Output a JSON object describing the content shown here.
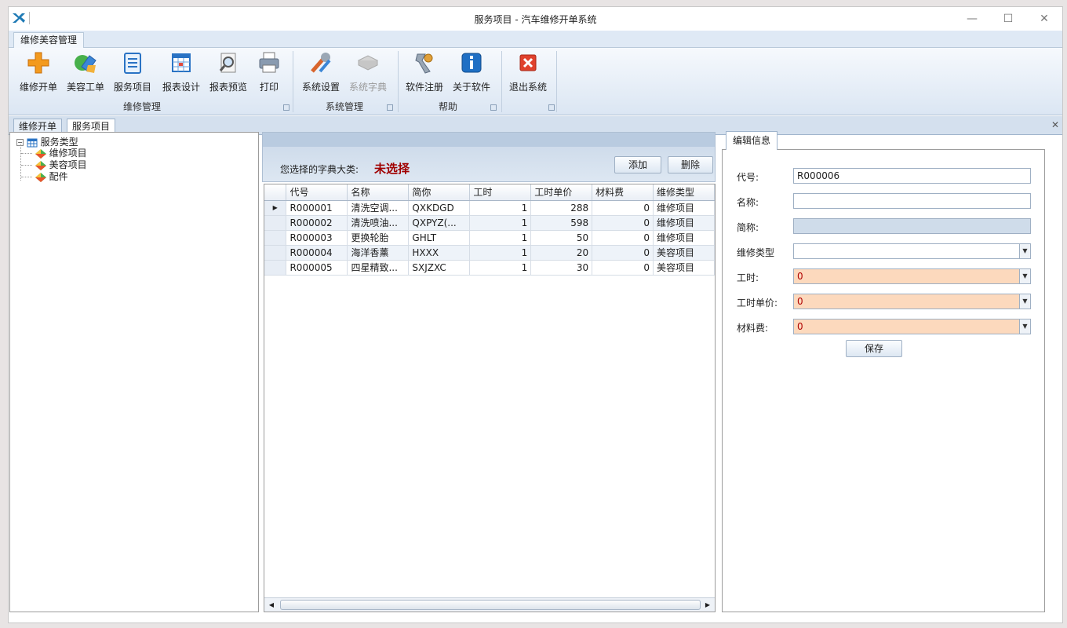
{
  "window": {
    "title": "服务项目 -      汽车维修开单系统",
    "minimize": "—",
    "maximize": "☐",
    "close": "✕"
  },
  "ribbon": {
    "tab": "维修美容管理",
    "buttons": [
      {
        "label": "维修开单",
        "icon": "plus-icon"
      },
      {
        "label": "美容工单",
        "icon": "car-wash-icon"
      },
      {
        "label": "服务项目",
        "icon": "checklist-icon"
      },
      {
        "label": "报表设计",
        "icon": "calendar-grid-icon"
      },
      {
        "label": "报表预览",
        "icon": "magnifier-icon"
      },
      {
        "label": "打印",
        "icon": "printer-icon"
      },
      {
        "label": "系统设置",
        "icon": "tools-icon"
      },
      {
        "label": "系统字典",
        "icon": "book-icon"
      },
      {
        "label": "软件注册",
        "icon": "key-icon"
      },
      {
        "label": "关于软件",
        "icon": "info-icon"
      },
      {
        "label": "退出系统",
        "icon": "exit-icon"
      }
    ],
    "groups": [
      "维修管理",
      "系统管理",
      "帮助"
    ]
  },
  "doc_tabs": [
    "维修开单",
    "服务项目"
  ],
  "tree": {
    "root": "服务类型",
    "children": [
      "维修项目",
      "美容项目",
      "配件"
    ]
  },
  "middle": {
    "select_label": "您选择的字典大类:",
    "select_value": "未选择",
    "add": "添加",
    "delete": "删除",
    "columns": [
      "代号",
      "名称",
      "简你",
      "工时",
      "工时单价",
      "材料费",
      "维修类型"
    ],
    "rows": [
      [
        "R000001",
        "清洗空调...",
        "QXKDGD",
        "1",
        "288",
        "0",
        "维修项目"
      ],
      [
        "R000002",
        "清洗喷油...",
        "QXPYZ(...",
        "1",
        "598",
        "0",
        "维修项目"
      ],
      [
        "R000003",
        "更换轮胎",
        "GHLT",
        "1",
        "50",
        "0",
        "维修项目"
      ],
      [
        "R000004",
        "海洋香薰",
        "HXXX",
        "1",
        "20",
        "0",
        "美容项目"
      ],
      [
        "R000005",
        "四星精致...",
        "SXJZXC",
        "1",
        "30",
        "0",
        "美容项目"
      ]
    ]
  },
  "edit": {
    "tab": "编辑信息",
    "fields": [
      {
        "label": "代号:",
        "value": "R000006"
      },
      {
        "label": "名称:",
        "value": ""
      },
      {
        "label": "简称:",
        "value": ""
      },
      {
        "label": "维修类型",
        "value": ""
      },
      {
        "label": "工时:",
        "value": "0"
      },
      {
        "label": "工时单价:",
        "value": "0"
      },
      {
        "label": "材料费:",
        "value": "0"
      }
    ],
    "save": "保存"
  }
}
